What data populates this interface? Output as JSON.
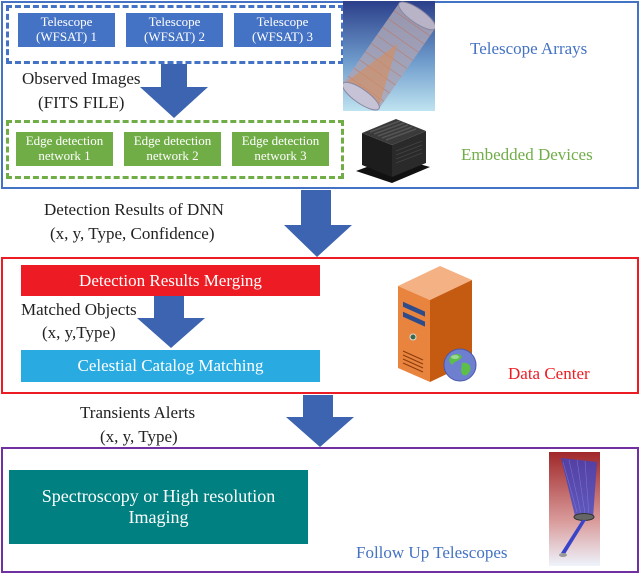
{
  "telescope_arrays": {
    "section_label": "Telescope Arrays",
    "telescopes": [
      "Telescope (WFSAT) 1",
      "Telescope (WFSAT) 2",
      "Telescope (WFSAT) 3"
    ],
    "telescope_lines": [
      [
        "Telescope",
        "(WFSAT) 1"
      ],
      [
        "Telescope",
        "(WFSAT) 2"
      ],
      [
        "Telescope",
        "(WFSAT) 3"
      ]
    ]
  },
  "observed_images": {
    "line1": "Observed Images",
    "line2": "(FITS FILE)"
  },
  "embedded_devices": {
    "section_label": "Embedded Devices",
    "networks": [
      [
        "Edge detection",
        "network 1"
      ],
      [
        "Edge detection",
        "network 2"
      ],
      [
        "Edge detection",
        "network 3"
      ]
    ]
  },
  "dnn_results": {
    "line1": "Detection Results of DNN",
    "line2": "(x, y, Type, Confidence)"
  },
  "data_center": {
    "section_label": "Data Center",
    "merging_label": "Detection Results Merging",
    "matched_line1": "Matched Objects",
    "matched_line2": "(x, y,Type)",
    "catalog_label": "Celestial Catalog Matching"
  },
  "transients": {
    "line1": "Transients Alerts",
    "line2": "(x, y, Type)"
  },
  "follow_up": {
    "section_label": "Follow Up Telescopes",
    "action_line1": "Spectroscopy or High resolution",
    "action_line2": "Imaging"
  },
  "colors": {
    "blue": "#4472c4",
    "green": "#70ad47",
    "red": "#ed1c24",
    "cyan": "#29abe2",
    "teal": "#008080",
    "purple": "#7030a0",
    "arrow": "#3c64b0"
  }
}
